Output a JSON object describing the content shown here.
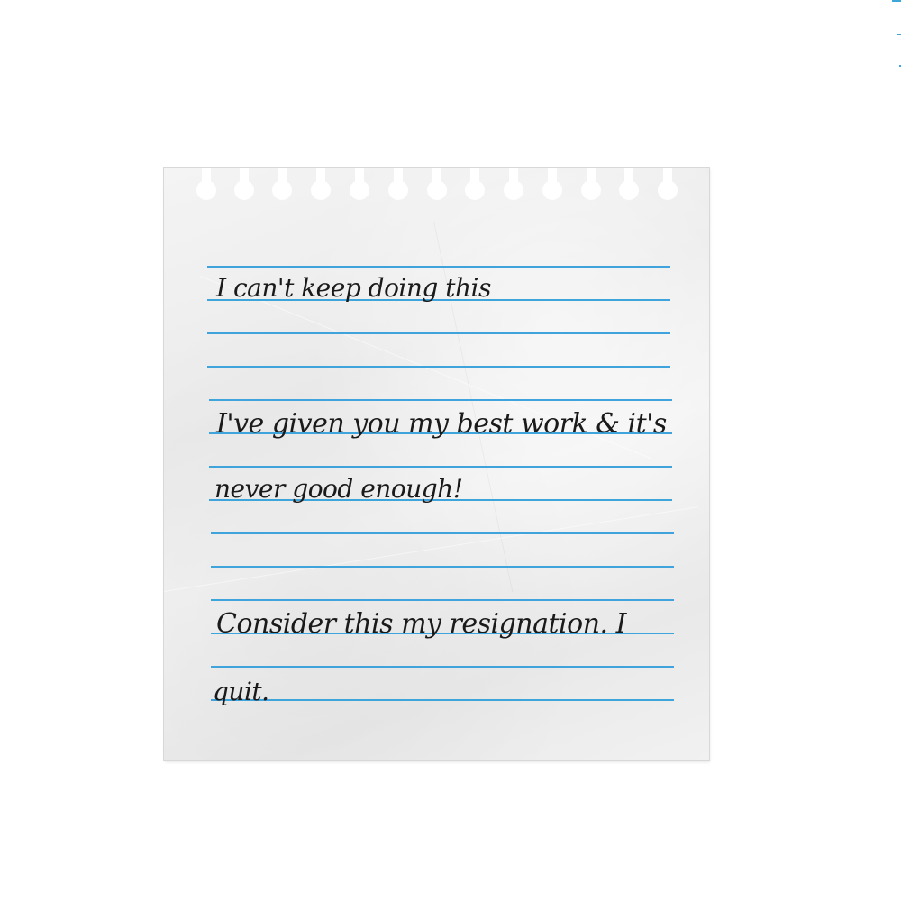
{
  "note": {
    "lines": [
      "I can't keep doing this",
      "I've given you my best work & it's",
      "never good enough!",
      "Consider this my resignation. I",
      "quit."
    ]
  },
  "colors": {
    "background": "#ffffff",
    "paper": "#efefef",
    "rule_line": "#3ea4db",
    "ink": "#1a1a1a"
  }
}
